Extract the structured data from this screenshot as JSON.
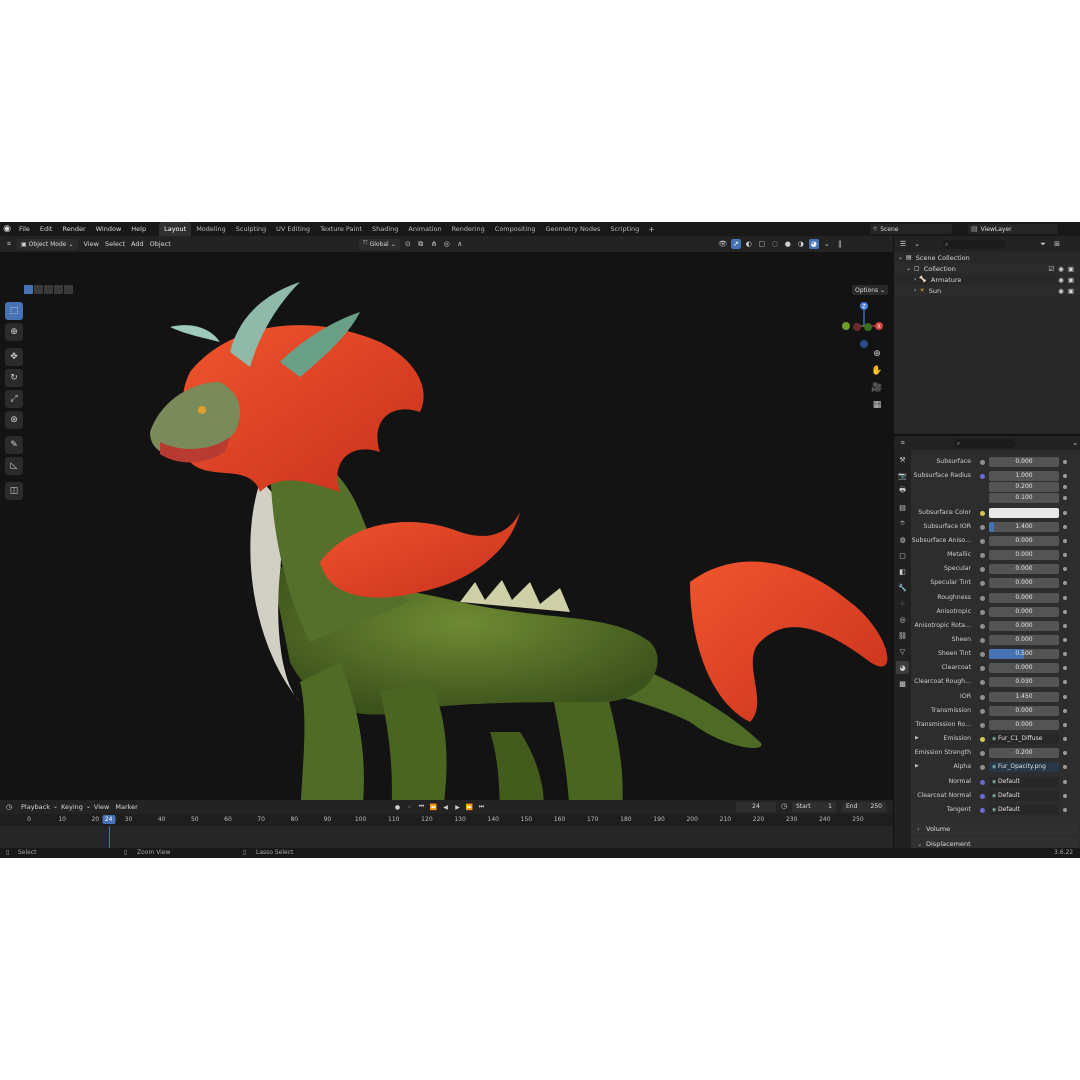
{
  "menu": [
    "File",
    "Edit",
    "Render",
    "Window",
    "Help"
  ],
  "workspaces": [
    {
      "label": "Layout",
      "active": true
    },
    {
      "label": "Modeling"
    },
    {
      "label": "Sculpting"
    },
    {
      "label": "UV Editing"
    },
    {
      "label": "Texture Paint"
    },
    {
      "label": "Shading"
    },
    {
      "label": "Animation"
    },
    {
      "label": "Rendering"
    },
    {
      "label": "Compositing"
    },
    {
      "label": "Geometry Nodes"
    },
    {
      "label": "Scripting"
    }
  ],
  "workspace_add": "+",
  "scene": "Scene",
  "view_layer": "ViewLayer",
  "viewport_header": {
    "mode": "Object Mode",
    "menus": [
      "View",
      "Select",
      "Add",
      "Object"
    ],
    "transform_orientation": "Global",
    "options": "Options"
  },
  "outliner": {
    "rows": [
      {
        "label": "Scene Collection",
        "icon": "scene-collection-icon",
        "indent": 0
      },
      {
        "label": "Collection",
        "icon": "collection-icon",
        "indent": 1
      },
      {
        "label": "Armature",
        "icon": "armature-icon",
        "indent": 2
      },
      {
        "label": "Sun",
        "icon": "sun-light-icon",
        "indent": 2
      }
    ]
  },
  "properties": {
    "rows": [
      {
        "label": "Subsurface",
        "value": "0.000",
        "dot": "gray"
      },
      {
        "label": "Subsurface Radius",
        "value": "1.000",
        "dot": "blue"
      },
      {
        "label": "",
        "value": "0.200"
      },
      {
        "label": "",
        "value": "0.100"
      },
      {
        "label": "Subsurface Color",
        "value": "",
        "dot": "yellow",
        "kind": "color"
      },
      {
        "label": "Subsurface IOR",
        "value": "1.400",
        "dot": "gray",
        "fill": 0.07
      },
      {
        "label": "Subsurface Aniso...",
        "value": "0.000",
        "dot": "gray"
      },
      {
        "label": "Metallic",
        "value": "0.000",
        "dot": "gray"
      },
      {
        "label": "Specular",
        "value": "0.000",
        "dot": "gray"
      },
      {
        "label": "Specular Tint",
        "value": "0.000",
        "dot": "gray"
      },
      {
        "label": "Roughness",
        "value": "0.000",
        "dot": "gray"
      },
      {
        "label": "Anisotropic",
        "value": "0.000",
        "dot": "gray"
      },
      {
        "label": "Anisotropic Rota...",
        "value": "0.000",
        "dot": "gray"
      },
      {
        "label": "Sheen",
        "value": "0.000",
        "dot": "gray"
      },
      {
        "label": "Sheen Tint",
        "value": "0.500",
        "dot": "gray",
        "fill": 0.5
      },
      {
        "label": "Clearcoat",
        "value": "0.000",
        "dot": "gray"
      },
      {
        "label": "Clearcoat Rough...",
        "value": "0.030",
        "dot": "gray"
      },
      {
        "label": "IOR",
        "value": "1.450",
        "dot": "gray"
      },
      {
        "label": "Transmission",
        "value": "0.000",
        "dot": "gray"
      },
      {
        "label": "Transmission Ro...",
        "value": "0.000",
        "dot": "gray"
      },
      {
        "label": "Emission",
        "value": "Fur_C1_Diffuse",
        "dot": "yellow",
        "kind": "texture",
        "expand": true
      },
      {
        "label": "Emission Strength",
        "value": "0.200",
        "dot": "gray"
      },
      {
        "label": "Alpha",
        "value": "Fur_Opacity.png",
        "dot": "gray",
        "kind": "texture",
        "expand": true,
        "selected": true
      },
      {
        "label": "Normal",
        "value": "Default",
        "dot": "blue",
        "kind": "texture"
      },
      {
        "label": "Clearcoat Normal",
        "value": "Default",
        "dot": "blue",
        "kind": "texture"
      },
      {
        "label": "Tangent",
        "value": "Default",
        "dot": "blue",
        "kind": "texture"
      }
    ],
    "sections": [
      "Volume",
      "Displacement"
    ]
  },
  "timeline": {
    "menus": [
      "Playback",
      "Keying",
      "View",
      "Marker"
    ],
    "ticks": [
      0,
      10,
      20,
      30,
      40,
      50,
      60,
      70,
      80,
      90,
      100,
      110,
      120,
      130,
      140,
      150,
      160,
      170,
      180,
      190,
      200,
      210,
      220,
      230,
      240,
      250
    ],
    "current_frame": "24",
    "start_label": "Start",
    "start": "1",
    "end_label": "End",
    "end": "250"
  },
  "status": {
    "select": "Select",
    "zoom": "Zoom View",
    "lasso": "Lasso Select",
    "version": "3.6.22"
  },
  "colors": {
    "accent": "#4772b3",
    "fur": "#e2452a",
    "scales": "#5d7a2a"
  }
}
